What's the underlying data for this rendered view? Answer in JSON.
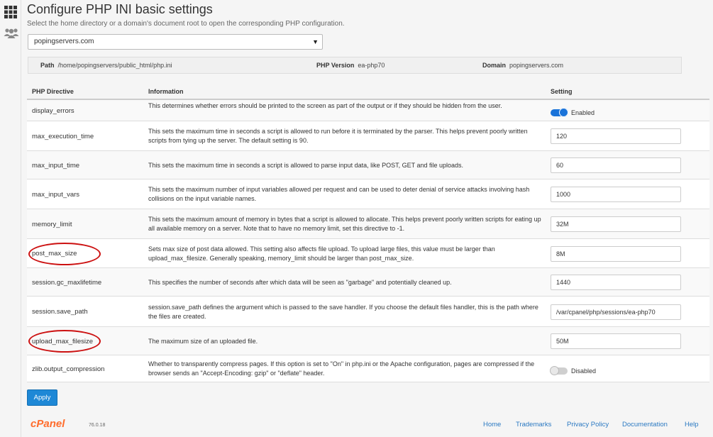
{
  "header": {
    "title": "Configure PHP INI basic settings",
    "subtitle": "Select the home directory or a domain's document root to open the corresponding PHP configuration."
  },
  "location_select": {
    "value": "popingservers.com"
  },
  "info_bar": {
    "path_label": "Path",
    "path_value": "/home/popingservers/public_html/php.ini",
    "version_label": "PHP Version",
    "version_value": "ea-php70",
    "domain_label": "Domain",
    "domain_value": "popingservers.com"
  },
  "table": {
    "headers": [
      "PHP Directive",
      "Information",
      "Setting"
    ],
    "rows": [
      {
        "directive": "display_errors",
        "info": "This determines whether errors should be printed to the screen as part of the output or if they should be hidden from the user.",
        "type": "toggle",
        "state": "on",
        "label": "Enabled"
      },
      {
        "directive": "max_execution_time",
        "info": "This sets the maximum time in seconds a script is allowed to run before it is terminated by the parser. This helps prevent poorly written scripts from tying up the server. The default setting is 90.",
        "type": "input",
        "value": "120"
      },
      {
        "directive": "max_input_time",
        "info": "This sets the maximum time in seconds a script is allowed to parse input data, like POST, GET and file uploads.",
        "type": "input",
        "value": "60"
      },
      {
        "directive": "max_input_vars",
        "info": "This sets the maximum number of input variables allowed per request and can be used to deter denial of service attacks involving hash collisions on the input variable names.",
        "type": "input",
        "value": "1000"
      },
      {
        "directive": "memory_limit",
        "info": "This sets the maximum amount of memory in bytes that a script is allowed to allocate. This helps prevent poorly written scripts for eating up all available memory on a server. Note that to have no memory limit, set this directive to -1.",
        "type": "input",
        "value": "32M"
      },
      {
        "directive": "post_max_size",
        "info": "Sets max size of post data allowed. This setting also affects file upload. To upload large files, this value must be larger than upload_max_filesize. Generally speaking, memory_limit should be larger than post_max_size.",
        "type": "input",
        "value": "8M"
      },
      {
        "directive": "session.gc_maxlifetime",
        "info": "This specifies the number of seconds after which data will be seen as \"garbage\" and potentially cleaned up.",
        "type": "input",
        "value": "1440"
      },
      {
        "directive": "session.save_path",
        "info": "session.save_path defines the argument which is passed to the save handler. If you choose the default files handler, this is the path where the files are created.",
        "type": "input",
        "value": "/var/cpanel/php/sessions/ea-php70"
      },
      {
        "directive": "upload_max_filesize",
        "info": "The maximum size of an uploaded file.",
        "type": "input",
        "value": "50M"
      },
      {
        "directive": "zlib.output_compression",
        "info": "Whether to transparently compress pages. If this option is set to \"On\" in php.ini or the Apache configuration, pages are compressed if the browser sends an \"Accept-Encoding: gzip\" or \"deflate\" header.",
        "type": "toggle",
        "state": "off",
        "label": "Disabled"
      }
    ]
  },
  "apply_label": "Apply",
  "footer": {
    "logo": "cPanel",
    "version": "76.0.18",
    "links": [
      "Home",
      "Trademarks",
      "Privacy Policy",
      "Documentation",
      "Help"
    ]
  },
  "annotations": {
    "highlighted_rows": [
      "post_max_size",
      "upload_max_filesize"
    ],
    "color": "#cc1111"
  },
  "colors": {
    "accent": "#1e88d6",
    "toggle_on": "#1a73d9",
    "cpanel_orange": "#ff6c2c",
    "link": "#2b79c2"
  },
  "icons": {
    "apps": "grid-icon",
    "users": "users-icon",
    "dropdown": "chevron-down-icon"
  }
}
